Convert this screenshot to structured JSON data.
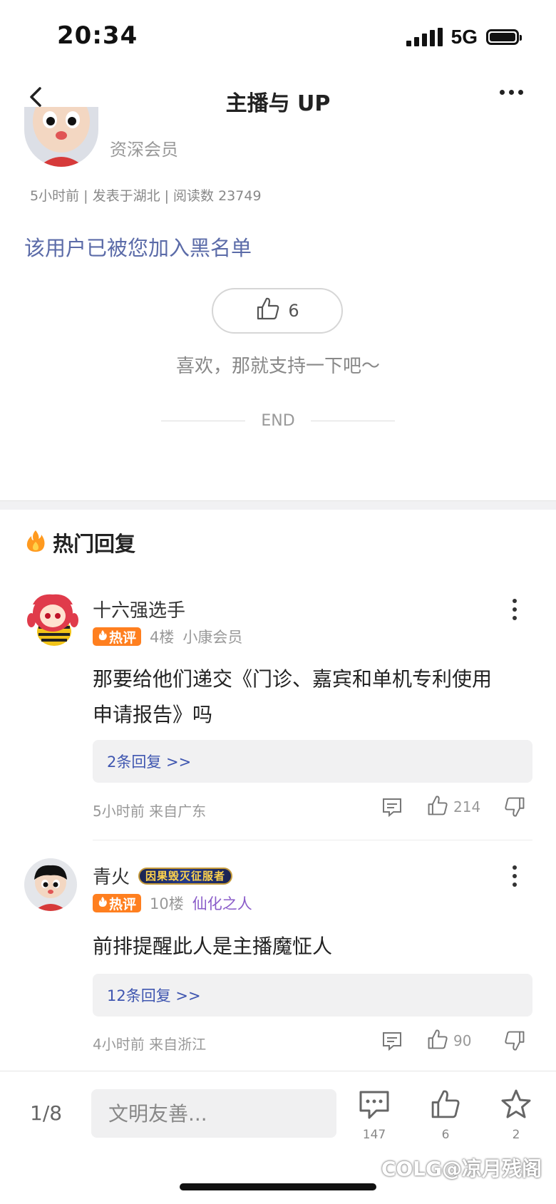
{
  "status_bar": {
    "time": "20:34",
    "network": "5G"
  },
  "nav": {
    "title": "主播与 UP"
  },
  "post": {
    "author_level": "资深会员",
    "meta": "5小时前 | 发表于湖北 | 阅读数 23749",
    "blacklist_notice": "该用户已被您加入黑名单",
    "like_count": "6",
    "like_hint": "喜欢，那就支持一下吧～",
    "end_label": "END"
  },
  "hot_replies": {
    "title": "热门回复",
    "comments": [
      {
        "name": "十六强选手",
        "badge": "热评",
        "floor": "4楼",
        "level": "小康会员",
        "text_line1": "那要给他们递交《门诊、嘉宾和单机专利使用",
        "text_line2": "申请报告》吗",
        "replies": "2条回复 >>",
        "time_loc": "5小时前 来自广东",
        "likes": "214"
      },
      {
        "name": "青火",
        "medal": "因果毁灭征服者",
        "badge": "热评",
        "floor": "10楼",
        "level": "仙化之人",
        "text_line1": "前排提醒此人是主播魔怔人",
        "replies": "12条回复 >>",
        "time_loc": "4小时前 来自浙江",
        "likes": "90"
      }
    ]
  },
  "bottom_bar": {
    "page_indicator": "1/8",
    "input_placeholder": "文明友善...",
    "comment_count": "147",
    "like_count": "6",
    "favorite_count": "2"
  },
  "watermark": "COLG@凉月残阁",
  "colors": {
    "accent_link": "#3f56b0",
    "hot_badge": "#ff7f1f",
    "level_purple": "#8a5cc9"
  },
  "icons": [
    "back-arrow-icon",
    "more-icon",
    "thumbs-up-icon",
    "fire-icon",
    "comment-icon",
    "thumbs-down-icon",
    "star-icon"
  ]
}
